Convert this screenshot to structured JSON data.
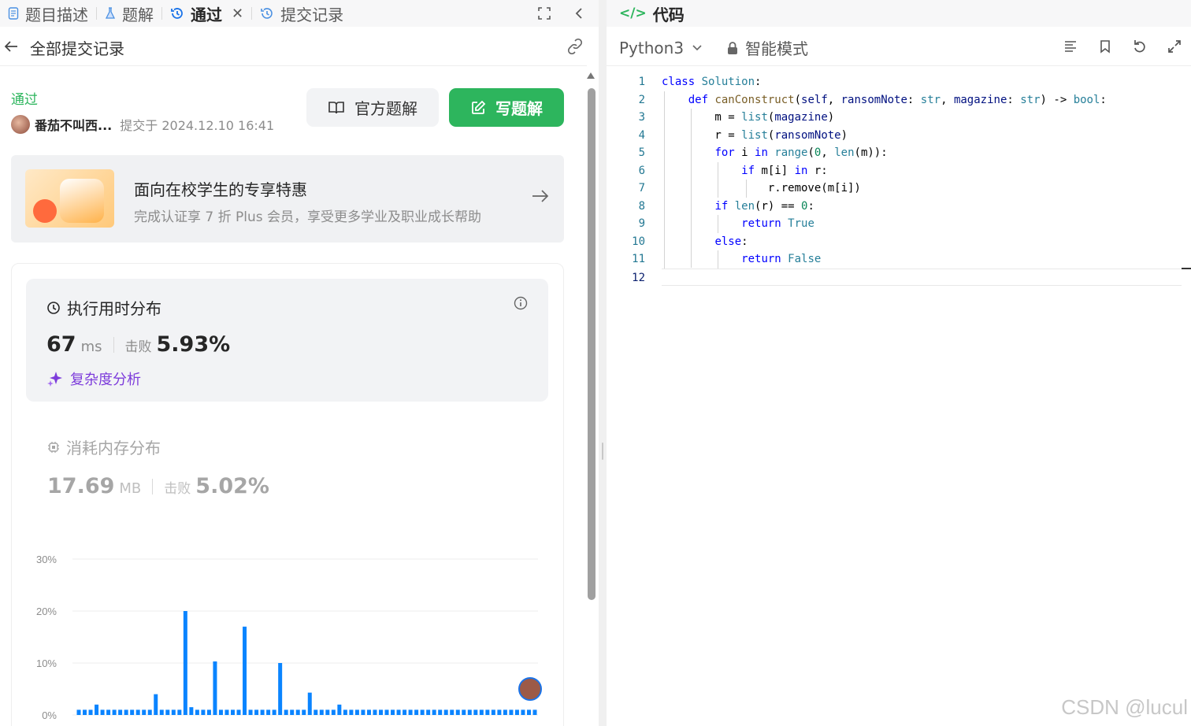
{
  "left_tabs": [
    {
      "label": "题目描述",
      "icon": "document-icon"
    },
    {
      "label": "题解",
      "icon": "flask-icon"
    },
    {
      "label": "通过",
      "icon": "history-icon",
      "active": true
    },
    {
      "label": "提交记录",
      "icon": "history-icon"
    }
  ],
  "subheader": {
    "title": "全部提交记录"
  },
  "submission": {
    "status": "通过",
    "author": "番茄不叫西...",
    "submitted_at": "提交于 2024.12.10 16:41"
  },
  "buttons": {
    "official": "官方题解",
    "write": "写题解"
  },
  "promo": {
    "title": "面向在校学生的专享特惠",
    "subtitle": "完成认证享 7 折 Plus 会员，享受更多学业及职业成长帮助"
  },
  "runtime": {
    "title": "执行用时分布",
    "value": "67",
    "unit": "ms",
    "beat_label": "击败",
    "beat_value": "5.93%",
    "complexity_link": "复杂度分析"
  },
  "memory": {
    "title": "消耗内存分布",
    "value": "17.69",
    "unit": "MB",
    "beat_label": "击败",
    "beat_value": "5.02%"
  },
  "chart_data": {
    "type": "bar",
    "y_ticks": [
      "30%",
      "20%",
      "10%",
      "0%"
    ],
    "ylim": [
      0,
      30
    ],
    "values": [
      1,
      1,
      1,
      2,
      1,
      1,
      1,
      1,
      1,
      1,
      1,
      1,
      1,
      4,
      1,
      1,
      1,
      1,
      20,
      1.5,
      1,
      1,
      1,
      10.3,
      1,
      1,
      1,
      1,
      17,
      1,
      1,
      1,
      1,
      1,
      10,
      1,
      1,
      1,
      1,
      4.3,
      1,
      1,
      1,
      1,
      2,
      1,
      1,
      1,
      1,
      1,
      1,
      1,
      1,
      1,
      1,
      1,
      1,
      1,
      1,
      1,
      1,
      1,
      1,
      1,
      1,
      1,
      1,
      1,
      1,
      1,
      1,
      1,
      1,
      1,
      1,
      1,
      1,
      1
    ],
    "color": "#0a84ff"
  },
  "code_panel": {
    "tab_label": "代码",
    "language": "Python3",
    "mode": "智能模式"
  },
  "code_lines": [
    "class Solution:",
    "    def canConstruct(self, ransomNote: str, magazine: str) -> bool:",
    "        m = list(magazine)",
    "        r = list(ransomNote)",
    "        for i in range(0, len(m)):",
    "            if m[i] in r:",
    "                r.remove(m[i])",
    "        if len(r) == 0:",
    "            return True",
    "        else:",
    "            return False",
    ""
  ],
  "watermark": "CSDN @lucul",
  "colors": {
    "accent_green": "#2db55d",
    "bar_blue": "#0a84ff",
    "complexity_purple": "#7d3cdb"
  }
}
